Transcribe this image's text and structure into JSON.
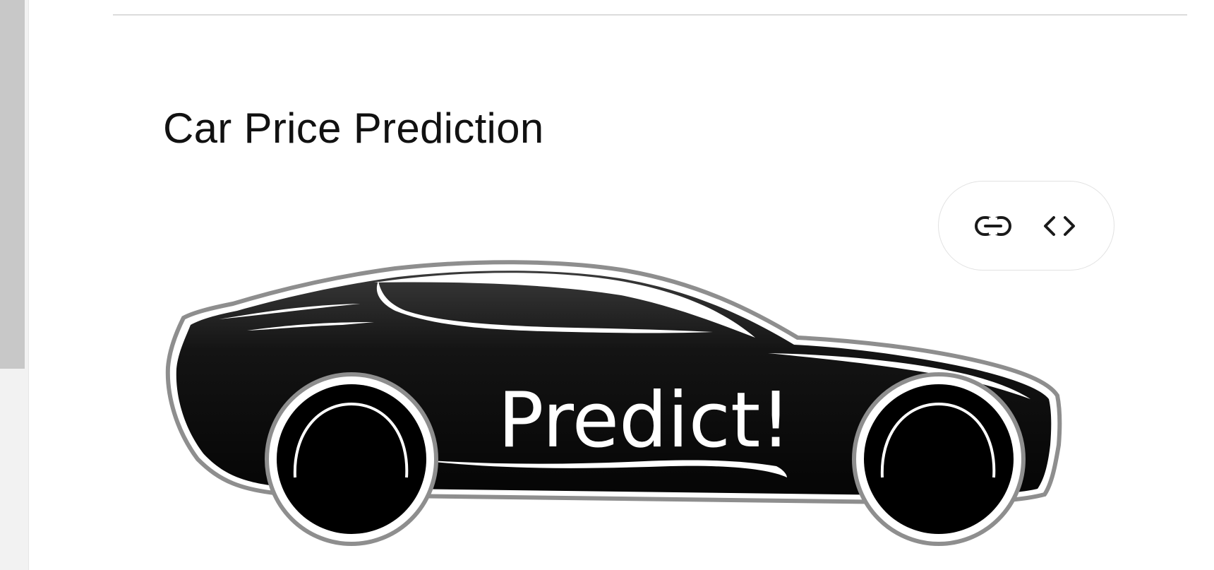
{
  "page": {
    "title": "Car Price Prediction"
  },
  "toolbar": {
    "items": [
      {
        "icon": "link-icon",
        "action": "copy-link"
      },
      {
        "icon": "code-icon",
        "action": "embed-code"
      }
    ]
  },
  "car_button": {
    "label": "Predict!"
  },
  "colors": {
    "car_body": "#0b0b0b",
    "car_outline": "#8e8e8e",
    "scrollbar_track": "#f2f2f2",
    "scrollbar_thumb": "#c8c8c8",
    "divider": "#dcdcdc",
    "text": "#111111"
  }
}
